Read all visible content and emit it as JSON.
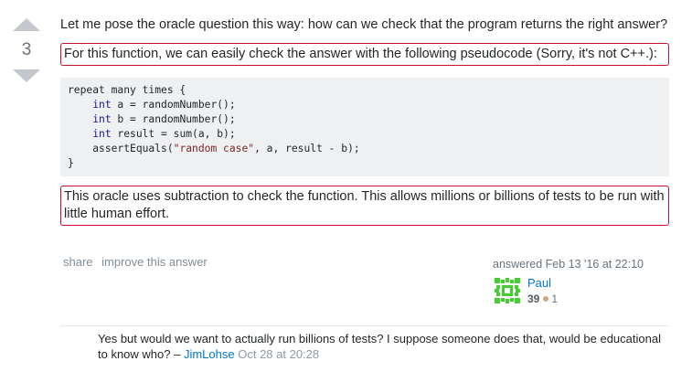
{
  "vote": {
    "count": "3"
  },
  "post": {
    "paragraph1": "Let me pose the oracle question this way: how can we check that the program returns the right answer?",
    "paragraph2": "For this function, we can easily check the answer with the following pseudocode (Sorry, it's not C++.):",
    "code": {
      "l1": "repeat many times {",
      "l2_kw": "int",
      "l2_rest": " a = randomNumber();",
      "l3_kw": "int",
      "l3_rest": " b = randomNumber();",
      "l4_kw": "int",
      "l4_rest": " result = sum(a, b);",
      "l5_pre": "assertEquals(",
      "l5_str": "\"random case\"",
      "l5_post": ", a, result - b);",
      "l6": "}"
    },
    "paragraph3": "This oracle uses subtraction to check the function. This allows millions or billions of tests to be run with little human effort."
  },
  "menu": {
    "share": "share",
    "improve": "improve this answer"
  },
  "signature": {
    "action": "answered Feb 13 '16 at 22:10",
    "username": "Paul",
    "reputation": "39",
    "bronze": "1"
  },
  "comment": {
    "text": "Yes but would we want to actually run billions of tests? I suppose someone does that, would be educational to know who?",
    "separator": " – ",
    "user": "JimLohse",
    "date": "Oct 28 at 20:28"
  },
  "colors": {
    "highlight_border": "#c8102e",
    "link": "#0077cc",
    "avatar": "#42d02e"
  }
}
